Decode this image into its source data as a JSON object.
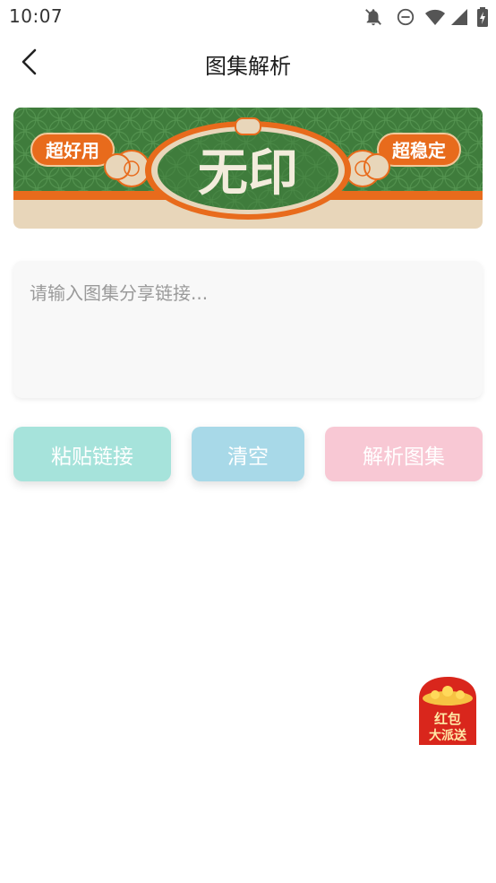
{
  "status_bar": {
    "time": "10:07",
    "icons": [
      "notifications-off-icon",
      "do-not-disturb-icon",
      "wifi-icon",
      "signal-icon",
      "battery-charging-icon"
    ]
  },
  "header": {
    "back_icon": "chevron-left-icon",
    "title": "图集解析"
  },
  "banner": {
    "left_tag": "超好用",
    "center_text": "无印",
    "right_tag": "超稳定",
    "colors": {
      "green": "#3f7c3c",
      "orange": "#e86b1c",
      "cream": "#e8d6ba"
    }
  },
  "link_input": {
    "value": "",
    "placeholder": "请输入图集分享链接..."
  },
  "buttons": {
    "paste_label": "粘贴链接",
    "clear_label": "清空",
    "parse_label": "解析图集",
    "colors": {
      "paste": "#a6e3db",
      "clear": "#a8d9e8",
      "parse": "#f8c8d4"
    }
  },
  "red_packet": {
    "line1": "红包",
    "line2": "大派送"
  }
}
